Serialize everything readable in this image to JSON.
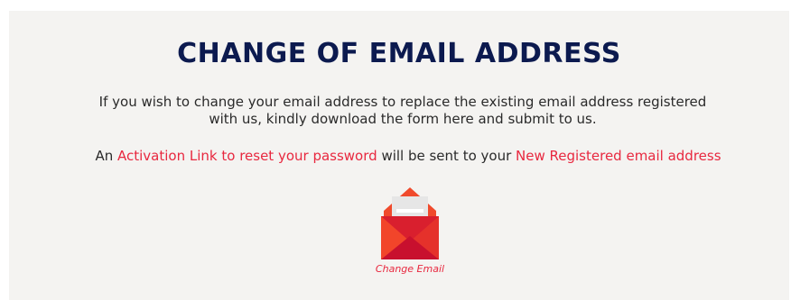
{
  "heading": "CHANGE OF EMAIL ADDRESS",
  "intro": {
    "line1": "If you wish to change your email address to replace the existing email address registered",
    "line2": "with us, kindly download the form here and submit to us."
  },
  "notice": {
    "prefix": "An ",
    "activation_link": "Activation Link to reset your password",
    "middle": " will be sent to your ",
    "new_email": "New Registered email address"
  },
  "action": {
    "label": "Change Email",
    "icon": "open-envelope-icon"
  },
  "colors": {
    "heading": "#0c1a4f",
    "accent": "#e8283f",
    "panel": "#f4f3f1"
  }
}
